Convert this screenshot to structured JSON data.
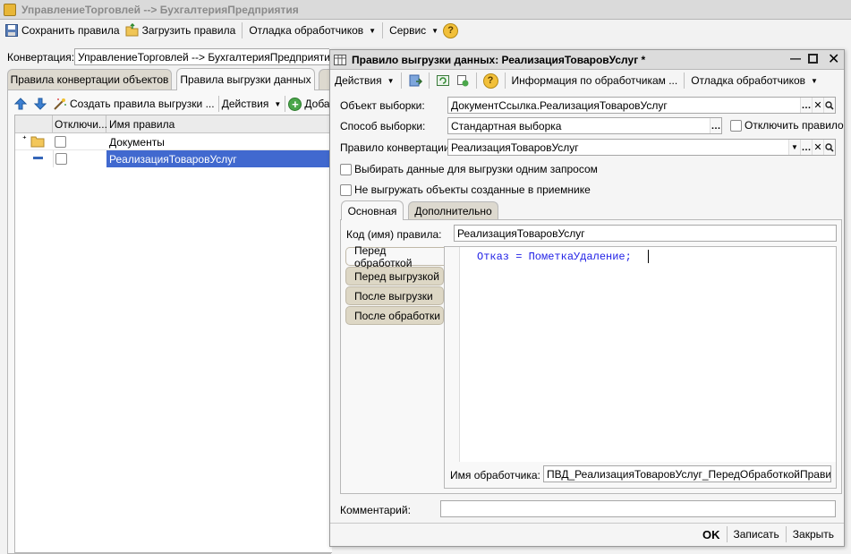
{
  "window": {
    "title": "УправлениеТорговлей --> БухгалтерияПредприятия"
  },
  "toolbar": {
    "save_rules": "Сохранить правила",
    "load_rules": "Загрузить правила",
    "debug_handlers": "Отладка обработчиков",
    "service": "Сервис"
  },
  "conversion": {
    "label": "Конвертация:",
    "value": "УправлениеТорговлей --> БухгалтерияПредприятия"
  },
  "main_tabs": [
    "Правила конвертации объектов",
    "Правила выгрузки данных"
  ],
  "list_toolbar": {
    "create_rules": "Создать правила выгрузки ...",
    "actions": "Действия",
    "add": "Добав"
  },
  "list": {
    "columns": [
      "Отключи...",
      "Имя правила"
    ],
    "rows": [
      {
        "name": "Документы",
        "kind": "folder"
      },
      {
        "name": "РеализацияТоваровУслуг",
        "kind": "item",
        "selected": true
      }
    ]
  },
  "dialog": {
    "title": "Правило выгрузки данных: РеализацияТоваровУслуг *",
    "toolbar": {
      "actions": "Действия",
      "handlers_info": "Информация по обработчикам ...",
      "debug_handlers": "Отладка обработчиков"
    },
    "object_label": "Объект выборки:",
    "object_value": "ДокументСсылка.РеализацияТоваровУслуг",
    "method_label": "Способ выборки:",
    "method_value": "Стандартная выборка",
    "disable_rule": "Отключить правило",
    "conv_rule_label": "Правило конвертации:",
    "conv_rule_value": "РеализацияТоваровУслуг",
    "single_query": "Выбирать данные для выгрузки одним запросом",
    "no_export_created": "Не выгружать объекты созданные в приемнике",
    "tabs": [
      "Основная",
      "Дополнительно"
    ],
    "code_label": "Код (имя) правила:",
    "code_value": "РеализацияТоваровУслуг",
    "handler_tabs": [
      "Перед обработкой",
      "Перед выгрузкой",
      "После выгрузки",
      "После обработки"
    ],
    "code_text": "Отказ = ПометкаУдаление;",
    "handler_name_label": "Имя обработчика:",
    "handler_name_value": "ПВД_РеализацияТоваровУслуг_ПередОбработкойПравила",
    "comment_label": "Комментарий:",
    "comment_value": "",
    "buttons": {
      "ok": "OK",
      "save": "Записать",
      "close": "Закрыть"
    }
  },
  "colors": {
    "selection": "#4169cf",
    "code": "#1e1ee6",
    "titlebar": "#dadada"
  }
}
